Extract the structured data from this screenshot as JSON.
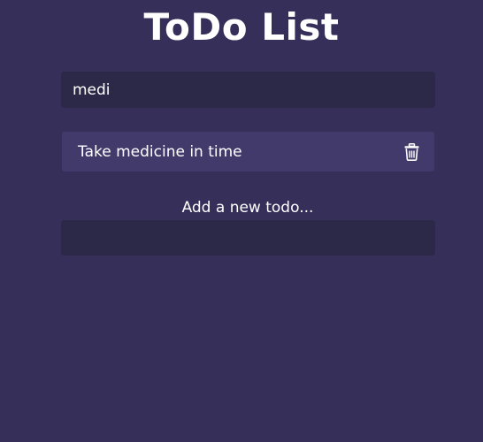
{
  "header": {
    "title": "ToDo List"
  },
  "search": {
    "value": "medi"
  },
  "todos": {
    "items": [
      {
        "text": "Take medicine in time",
        "action_icon": "trash-icon"
      }
    ]
  },
  "add_form": {
    "label": "Add a new todo...",
    "value": ""
  },
  "colors": {
    "background": "#352f5a",
    "input_background": "#2c2848",
    "item_background": "#433a6c",
    "text": "#ffffff"
  }
}
